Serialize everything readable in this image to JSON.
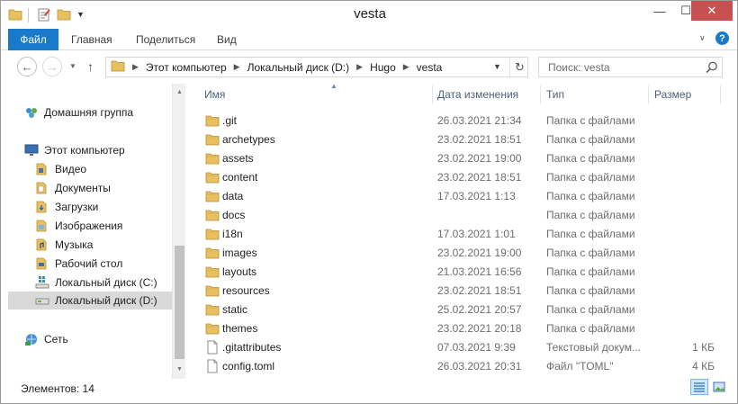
{
  "window": {
    "title": "vesta"
  },
  "icons": {
    "quick_folder": "folder-icon",
    "properties": "properties-icon",
    "new_folder": "new-folder-icon",
    "dropdown": "chevron-down-icon",
    "minimize": "minimize-icon",
    "maximize": "maximize-icon",
    "close": "close-icon",
    "help": "help-icon",
    "search": "search-icon",
    "refresh": "refresh-icon"
  },
  "ribbon": {
    "file_tab": "Файл",
    "tabs": [
      "Главная",
      "Поделиться",
      "Вид"
    ],
    "help_label": "?"
  },
  "address_bar": {
    "breadcrumbs": [
      "Этот компьютер",
      "Локальный диск (D:)",
      "Hugo",
      "vesta"
    ]
  },
  "search": {
    "placeholder": "Поиск: vesta"
  },
  "nav_pane": {
    "items": [
      {
        "label": "Домашняя группа",
        "icon": "homegroup-icon"
      },
      {
        "label": "Этот компьютер",
        "icon": "computer-icon"
      },
      {
        "label": "Видео",
        "icon": "videos-icon"
      },
      {
        "label": "Документы",
        "icon": "documents-icon"
      },
      {
        "label": "Загрузки",
        "icon": "downloads-icon"
      },
      {
        "label": "Изображения",
        "icon": "pictures-icon"
      },
      {
        "label": "Музыка",
        "icon": "music-icon"
      },
      {
        "label": "Рабочий стол",
        "icon": "desktop-icon"
      },
      {
        "label": "Локальный диск (C:)",
        "icon": "system-drive-icon"
      },
      {
        "label": "Локальный диск (D:)",
        "icon": "drive-icon",
        "selected": true
      },
      {
        "label": "Сеть",
        "icon": "network-icon"
      }
    ]
  },
  "file_list": {
    "columns": {
      "name": "Имя",
      "date": "Дата изменения",
      "type": "Тип",
      "size": "Размер"
    },
    "rows": [
      {
        "name": ".git",
        "date": "26.03.2021 21:34",
        "type": "Папка с файлами",
        "size": "",
        "icon": "folder-icon"
      },
      {
        "name": "archetypes",
        "date": "23.02.2021 18:51",
        "type": "Папка с файлами",
        "size": "",
        "icon": "folder-icon"
      },
      {
        "name": "assets",
        "date": "23.02.2021 19:00",
        "type": "Папка с файлами",
        "size": "",
        "icon": "folder-icon"
      },
      {
        "name": "content",
        "date": "23.02.2021 18:51",
        "type": "Папка с файлами",
        "size": "",
        "icon": "folder-icon"
      },
      {
        "name": "data",
        "date": "17.03.2021 1:13",
        "type": "Папка с файлами",
        "size": "",
        "icon": "folder-icon"
      },
      {
        "name": "docs",
        "date": "",
        "type": "Папка с файлами",
        "size": "",
        "icon": "folder-icon"
      },
      {
        "name": "i18n",
        "date": "17.03.2021 1:01",
        "type": "Папка с файлами",
        "size": "",
        "icon": "folder-icon"
      },
      {
        "name": "images",
        "date": "23.02.2021 19:00",
        "type": "Папка с файлами",
        "size": "",
        "icon": "folder-icon"
      },
      {
        "name": "layouts",
        "date": "21.03.2021 16:56",
        "type": "Папка с файлами",
        "size": "",
        "icon": "folder-icon"
      },
      {
        "name": "resources",
        "date": "23.02.2021 18:51",
        "type": "Папка с файлами",
        "size": "",
        "icon": "folder-icon"
      },
      {
        "name": "static",
        "date": "25.02.2021 20:57",
        "type": "Папка с файлами",
        "size": "",
        "icon": "folder-icon"
      },
      {
        "name": "themes",
        "date": "23.02.2021 20:18",
        "type": "Папка с файлами",
        "size": "",
        "icon": "folder-icon"
      },
      {
        "name": ".gitattributes",
        "date": "07.03.2021 9:39",
        "type": "Текстовый докум...",
        "size": "1 КБ",
        "icon": "file-icon"
      },
      {
        "name": "config.toml",
        "date": "26.03.2021 20:31",
        "type": "Файл \"TOML\"",
        "size": "4 КБ",
        "icon": "file-icon"
      }
    ]
  },
  "status_bar": {
    "item_count": "Элементов: 14"
  },
  "colors": {
    "accent": "#1979ca",
    "folder": "#e8c062",
    "close_button": "#c75050",
    "header_text": "#4c607a",
    "selection": "#d9d9d9"
  }
}
